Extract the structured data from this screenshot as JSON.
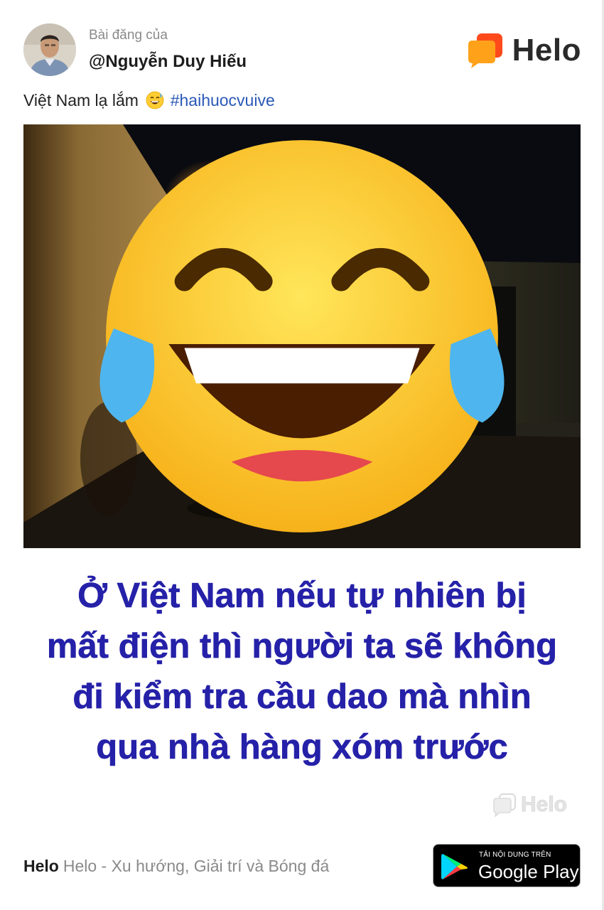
{
  "post": {
    "posted_by_label": "Bài đăng của",
    "username": "@Nguyễn Duy Hiếu",
    "caption_text": "Việt Nam lạ lắm",
    "caption_emoji": "sweat-smile-emoji",
    "hashtag": "#haihuocvuive"
  },
  "brand": {
    "name": "Helo",
    "logo_colors": [
      "#ff4a1c",
      "#ffa21a"
    ]
  },
  "image": {
    "overlay_emoji": "tears-of-joy-emoji",
    "meme_text_lines": [
      "Ở Việt Nam nếu tự nhiên bị",
      "mất điện thì người ta sẽ không",
      "đi kiểm tra cầu dao mà nhìn",
      "qua nhà hàng xóm trước"
    ],
    "meme_text_color": "#2521a8",
    "watermark": "Helo"
  },
  "footer": {
    "brand": "Helo",
    "tagline": "Helo - Xu hướng, Giải trí và Bóng đá",
    "store_badge": {
      "small_text": "TẢI NỘI DUNG TRÊN",
      "big_text": "Google Play"
    }
  }
}
